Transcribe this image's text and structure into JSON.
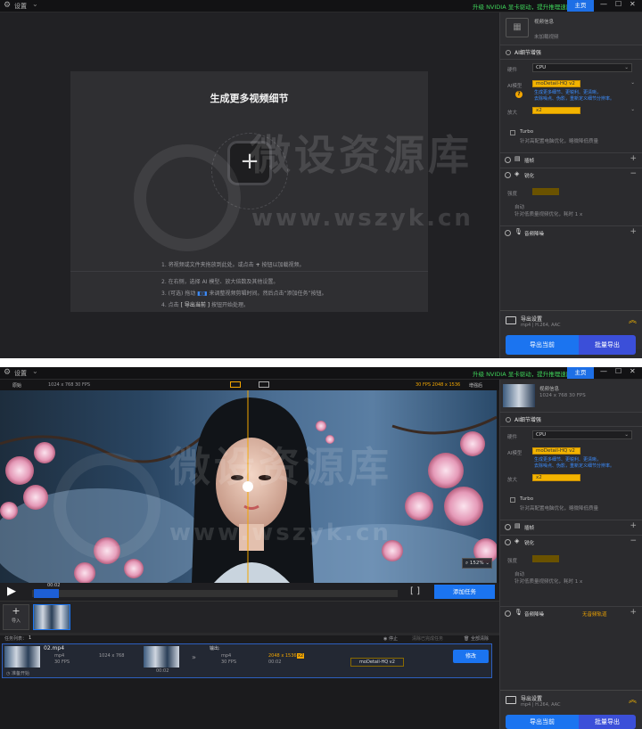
{
  "window1": {
    "titlebar": {
      "title": "设置",
      "upgrade_text": "升级 NVIDIA 显卡驱动，提升推理速度。",
      "home_label": "主页",
      "min_glyph": "—",
      "max_glyph": "☐",
      "close_glyph": "✕"
    },
    "dropzone": {
      "title": "生成更多视频细节",
      "plus": "+",
      "steps": [
        {
          "n": "1.",
          "pre": "将视频或文件夹拖放到此处。或点击",
          "key": "+",
          "post": "按钮以加载视频。"
        },
        {
          "n": "2.",
          "pre": "在右侧，选择 AI 模型、放大倍数及其他设置。",
          "key": "",
          "post": ""
        },
        {
          "n": "3.",
          "pre": "(可选) 拖动",
          "key": "◧◨",
          "post": "来调整视频剪辑时间。然后点击“添加任务”按钮。"
        },
        {
          "n": "4.",
          "pre": "点击",
          "key": "[ 导出当前 ]",
          "post": "按钮开始处理。"
        }
      ]
    },
    "sidebar": {
      "video_info_title": "视频信息",
      "video_info_sub": "未加载视频",
      "ai_enhance": "AI细节增强",
      "hardware_label": "硬件",
      "hardware_value": "CPU",
      "model_label": "AI模型",
      "model_value": "moDetail-HQ  v2",
      "model_desc_1": "生成更多细节、更锐利、更清晰，",
      "model_desc_2": "去除噪点、伪影，重新定义细节分辨率。",
      "scale_label": "放大",
      "scale_value": "x2",
      "turbo_label": "Turbo",
      "turbo_desc": "针对高配置电脑优化，略微降低质量",
      "frame_label": "插帧",
      "denoise_label": "锐化",
      "denoise_level": "强度",
      "denoise_sub1": "自动",
      "denoise_sub2": "针对低质量视频优化，耗时 1 x",
      "audio_label": "音频降噪",
      "export_title": "导出设置",
      "export_sub": "mp4 | H.264, AAC",
      "btn_export_current": "导出当前",
      "btn_export_batch": "批量导出"
    },
    "watermark": {
      "cn": "微设资源库",
      "url": "www.wszyk.cn"
    }
  },
  "window2": {
    "titlebar": {
      "title": "设置",
      "upgrade_text": "升级 NVIDIA 显卡驱动，提升推理速度。",
      "home_label": "主页"
    },
    "preview": {
      "left_label": "原始",
      "left_res": "1024 x 768  30 FPS",
      "right_label": "增强后",
      "right_res": "30 FPS  2048 x 1536",
      "zoom": "152%",
      "time": "00:02",
      "add_task": "添加任务",
      "import_label": "导入"
    },
    "tasks": {
      "list_label": "任务列表：",
      "count": "1",
      "action1": "停止",
      "action2": "清除已完成任务",
      "action3": "全部清除",
      "file_name": "02.mp4",
      "in_format": "mp4",
      "in_res": "1024 x 768",
      "in_fps": "30 FPS",
      "in_dur": "00:02",
      "out_label": "输出:",
      "out_format": "mp4",
      "out_res": "2048 x 1536",
      "out_scale": "x2",
      "out_fps": "30 FPS",
      "out_dur": "00:02",
      "out_model": "moDetail-HQ  v2",
      "edit_btn": "修改",
      "status": "准备开始"
    },
    "sidebar": {
      "video_info_title": "视频信息",
      "video_info_sub": "1024 x 768  30 FPS",
      "ai_enhance": "AI细节增强",
      "hardware_value": "CPU",
      "model_value": "moDetail-HQ  v2",
      "scale_value": "x2",
      "turbo_label": "Turbo",
      "frame_label": "插帧",
      "denoise_label": "锐化",
      "audio_label": "音频降噪",
      "audio_state": "无音频轨道",
      "export_title": "导出设置",
      "export_sub": "mp4 | H.264, AAC",
      "btn_export_current": "导出当前",
      "btn_export_batch": "批量导出"
    }
  }
}
